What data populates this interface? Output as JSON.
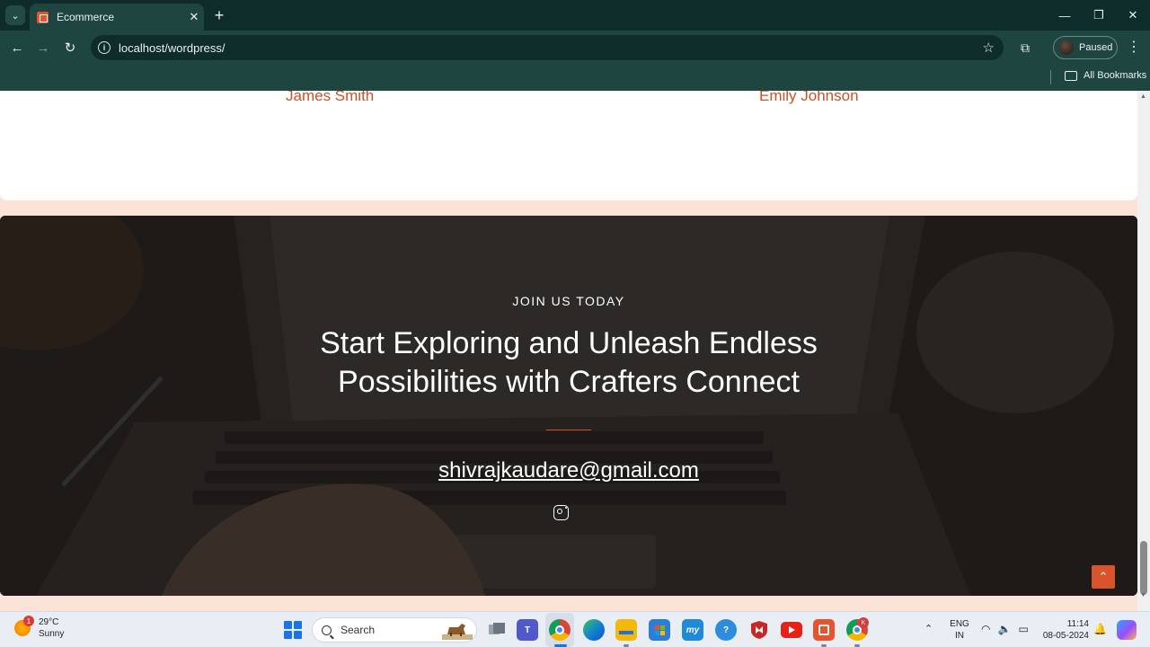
{
  "browser": {
    "tab_list_glyph": "⌄",
    "tab_title": "Ecommerce",
    "tab_close_glyph": "✕",
    "new_tab_glyph": "+",
    "window_controls": {
      "minimize": "—",
      "restore": "❐",
      "close": "✕"
    },
    "nav": {
      "back": "←",
      "forward": "→",
      "reload": "↻"
    },
    "url": "localhost/wordpress/",
    "info_glyph": "i",
    "star_glyph": "☆",
    "extensions_glyph": "⧉",
    "profile_label": "Paused",
    "menu_glyph": "⋮",
    "bookmarks_label": "All Bookmarks"
  },
  "testimonials": {
    "names": [
      "James Smith",
      "Emily Johnson"
    ]
  },
  "cta": {
    "eyebrow": "JOIN US TODAY",
    "heading_line1": "Start Exploring and Unleash Endless",
    "heading_line2": "Possibilities with Crafters Connect",
    "email": "shivrajkaudare@gmail.com",
    "scroll_top_glyph": "⌃"
  },
  "scrollbar": {
    "up": "▲",
    "down": "▼"
  },
  "taskbar": {
    "weather_temp": "29°C",
    "weather_desc": "Sunny",
    "weather_badge": "1",
    "search_label": "Search",
    "tray_overflow_glyph": "⌃",
    "lang_line1": "ENG",
    "lang_line2": "IN",
    "tray_wifi": "◠",
    "tray_volume": "🔈",
    "tray_battery": "▭",
    "time": "11:14",
    "date": "08-05-2024",
    "bell_glyph": "🔔",
    "chrome_badge": "K",
    "apps": [
      {
        "name": "task-view",
        "color": "#5b6573"
      },
      {
        "name": "teams",
        "color": "#5059c9",
        "label": "T"
      },
      {
        "name": "chrome",
        "color": "#e53935"
      },
      {
        "name": "edge",
        "color": "#0f7ad6"
      },
      {
        "name": "file-explorer",
        "color": "#f2b90c"
      },
      {
        "name": "store",
        "color": "#2d7cd6"
      },
      {
        "name": "mysql-workbench",
        "color": "#1f8ad6",
        "label": "my"
      },
      {
        "name": "help",
        "color": "#2e8cdc",
        "label": "?"
      },
      {
        "name": "mcafee",
        "color": "#c62828"
      },
      {
        "name": "youtube",
        "color": "#e62117"
      },
      {
        "name": "xampp",
        "color": "#e8522c"
      },
      {
        "name": "chrome-profile",
        "color": "#e53935"
      }
    ]
  }
}
